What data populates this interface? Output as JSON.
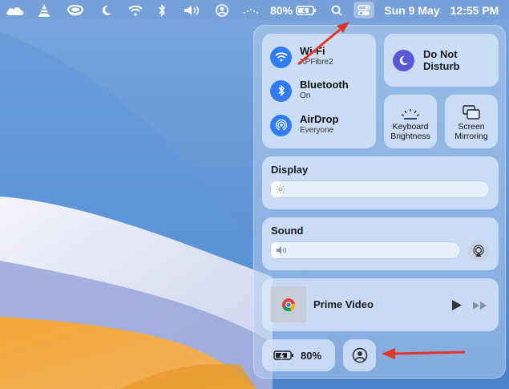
{
  "menubar": {
    "battery_percent": "80%",
    "date": "Sun 9 May",
    "time": "12:55 PM"
  },
  "control_center": {
    "wifi": {
      "title": "Wi-Fi",
      "subtitle": "XPFibre2"
    },
    "bluetooth": {
      "title": "Bluetooth",
      "subtitle": "On"
    },
    "airdrop": {
      "title": "AirDrop",
      "subtitle": "Everyone"
    },
    "do_not_disturb": {
      "label": "Do Not Disturb"
    },
    "keyboard_brightness": {
      "label_line1": "Keyboard",
      "label_line2": "Brightness"
    },
    "screen_mirroring": {
      "label_line1": "Screen",
      "label_line2": "Mirroring"
    },
    "display": {
      "title": "Display",
      "level": 0.05
    },
    "sound": {
      "title": "Sound",
      "level": 0.05
    },
    "now_playing": {
      "title": "Prime Video"
    },
    "battery": {
      "percent": "80%"
    }
  },
  "colors": {
    "accent_blue": "#2f7cf6",
    "dnd_purple": "#5b5ad6",
    "annotation_red": "#e0362b"
  }
}
